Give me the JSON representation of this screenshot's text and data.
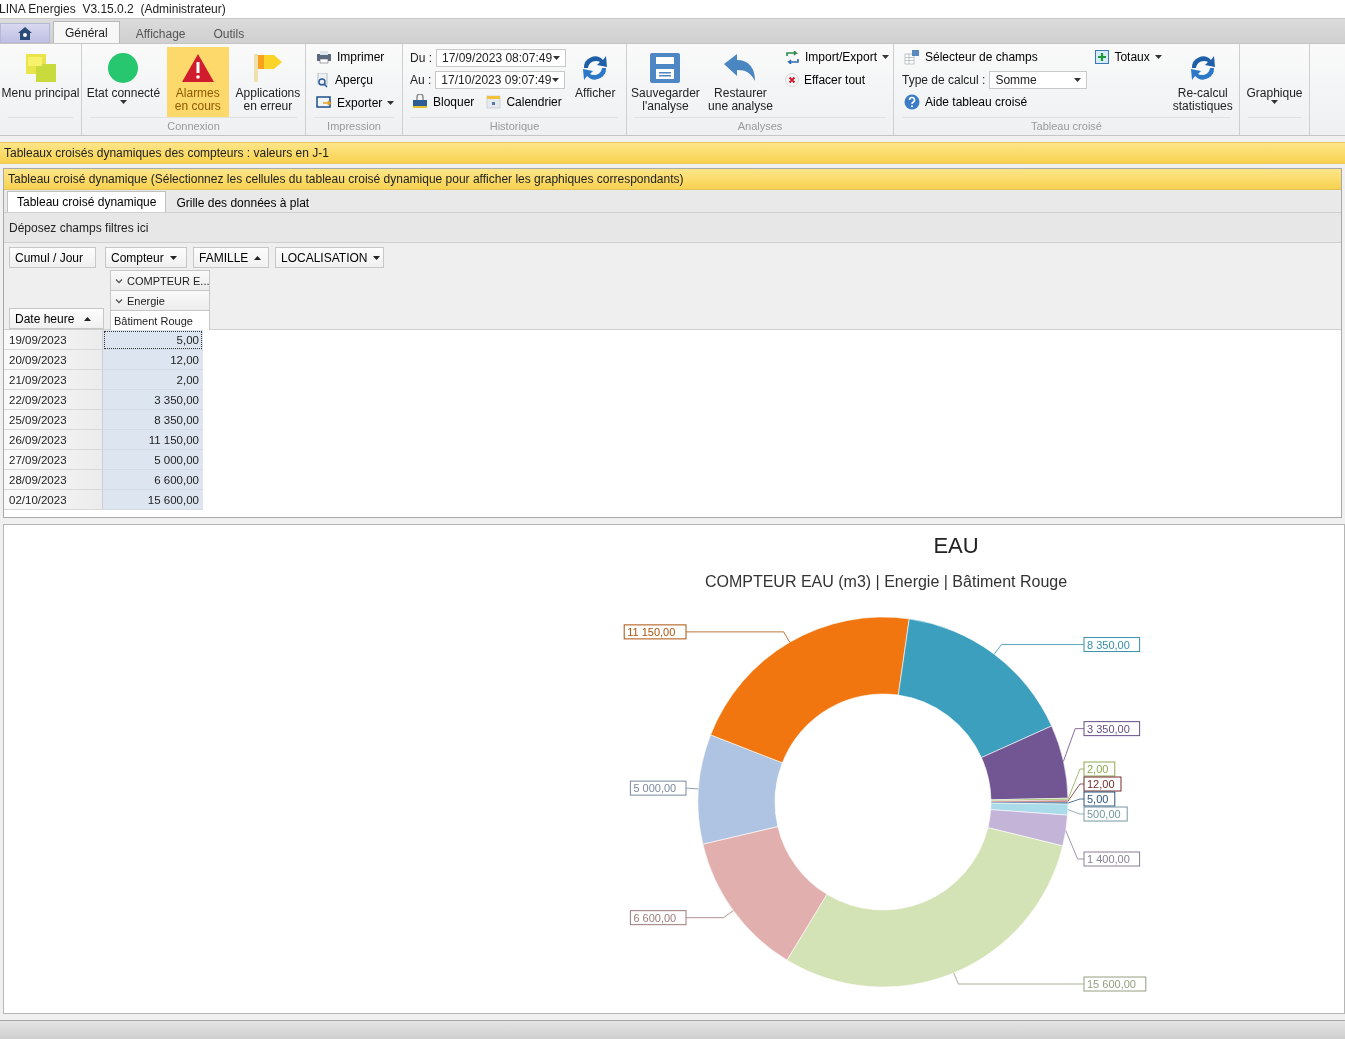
{
  "window": {
    "title": "LINA Energies  V3.15.0.2  (Administrateur)"
  },
  "ribbon_tabs": [
    {
      "label": "Général",
      "selected": true
    },
    {
      "label": "Affichage",
      "selected": false
    },
    {
      "label": "Outils",
      "selected": false
    }
  ],
  "ribbon": {
    "menu": {
      "label": "Menu principal"
    },
    "connection": {
      "caption": "Connexion",
      "status": {
        "label": "Etat connecté"
      },
      "alarms": {
        "label": "Alarmes\nen cours",
        "highlighted": true
      },
      "apps": {
        "label": "Applications\nen erreur"
      }
    },
    "printing": {
      "caption": "Impression",
      "print": "Imprimer",
      "preview": "Aperçu",
      "export": "Exporter"
    },
    "history": {
      "caption": "Historique",
      "from": {
        "label": "Du :",
        "value": "17/09/2023 08:07:49"
      },
      "to": {
        "label": "Au :",
        "value": "17/10/2023 09:07:49"
      },
      "lock": "Bloquer",
      "calendar": "Calendrier",
      "show": "Afficher"
    },
    "analyses": {
      "caption": "Analyses",
      "save": "Sauvegarder\nl'analyse",
      "restore": "Restaurer\nune analyse",
      "import_export": "Import/Export",
      "clear": "Effacer tout"
    },
    "pivot_tools": {
      "caption": "Tableau croisé",
      "field_selector": "Sélecteur de champs",
      "calc_type": {
        "label": "Type de calcul :",
        "value": "Somme"
      },
      "help": "Aide tableau croisé",
      "totals": "Totaux",
      "recalc": "Re-calcul\nstatistiques"
    },
    "chart_menu": {
      "label": "Graphique"
    }
  },
  "banner": "Tableaux croisés dynamiques des compteurs : valeurs en J-1",
  "pivot": {
    "title": "Tableau croisé dynamique (Sélectionnez les cellules du tableau croisé dynamique pour afficher les graphiques correspondants)",
    "tabs": [
      {
        "label": "Tableau croisé dynamique",
        "selected": true
      },
      {
        "label": "Grille des données à plat",
        "selected": false
      }
    ],
    "filter_hint": "Déposez champs filtres ici",
    "data_field": "Cumul / Jour",
    "column_fields": [
      {
        "label": "Compteur",
        "sort_ascending": false
      },
      {
        "label": "FAMILLE",
        "sort_ascending": true
      },
      {
        "label": "LOCALISATION",
        "sort_ascending": false
      }
    ],
    "column_headers": [
      {
        "label": "COMPTEUR E...",
        "expanded": true
      },
      {
        "label": "Energie",
        "expanded": true
      },
      {
        "label": "Bâtiment Rouge"
      }
    ],
    "row_field": {
      "label": "Date heure",
      "sort_ascending": true
    },
    "rows": [
      {
        "date": "19/09/2023",
        "value": "5,00",
        "selected": true
      },
      {
        "date": "20/09/2023",
        "value": "12,00",
        "selected": false
      },
      {
        "date": "21/09/2023",
        "value": "2,00",
        "selected": false
      },
      {
        "date": "22/09/2023",
        "value": "3 350,00",
        "selected": false
      },
      {
        "date": "25/09/2023",
        "value": "8 350,00",
        "selected": false
      },
      {
        "date": "26/09/2023",
        "value": "11 150,00",
        "selected": false
      },
      {
        "date": "27/09/2023",
        "value": "5 000,00",
        "selected": false
      },
      {
        "date": "28/09/2023",
        "value": "6 600,00",
        "selected": false
      },
      {
        "date": "02/10/2023",
        "value": "15 600,00",
        "selected": false
      }
    ]
  },
  "chart": {
    "title": "EAU",
    "subtitle": "COMPTEUR EAU (m3) | Energie | Bâtiment Rouge",
    "chart_data": {
      "type": "donut",
      "values": [
        5000,
        11150,
        8350,
        3350,
        2,
        12,
        5,
        500,
        1400,
        15600,
        6600
      ],
      "value_labels": [
        "5 000,00",
        "11 150,00",
        "8 350,00",
        "3 350,00",
        "2,00",
        "12,00",
        "5,00",
        "500,00",
        "1 400,00",
        "15 600,00",
        "6 600,00"
      ]
    }
  }
}
